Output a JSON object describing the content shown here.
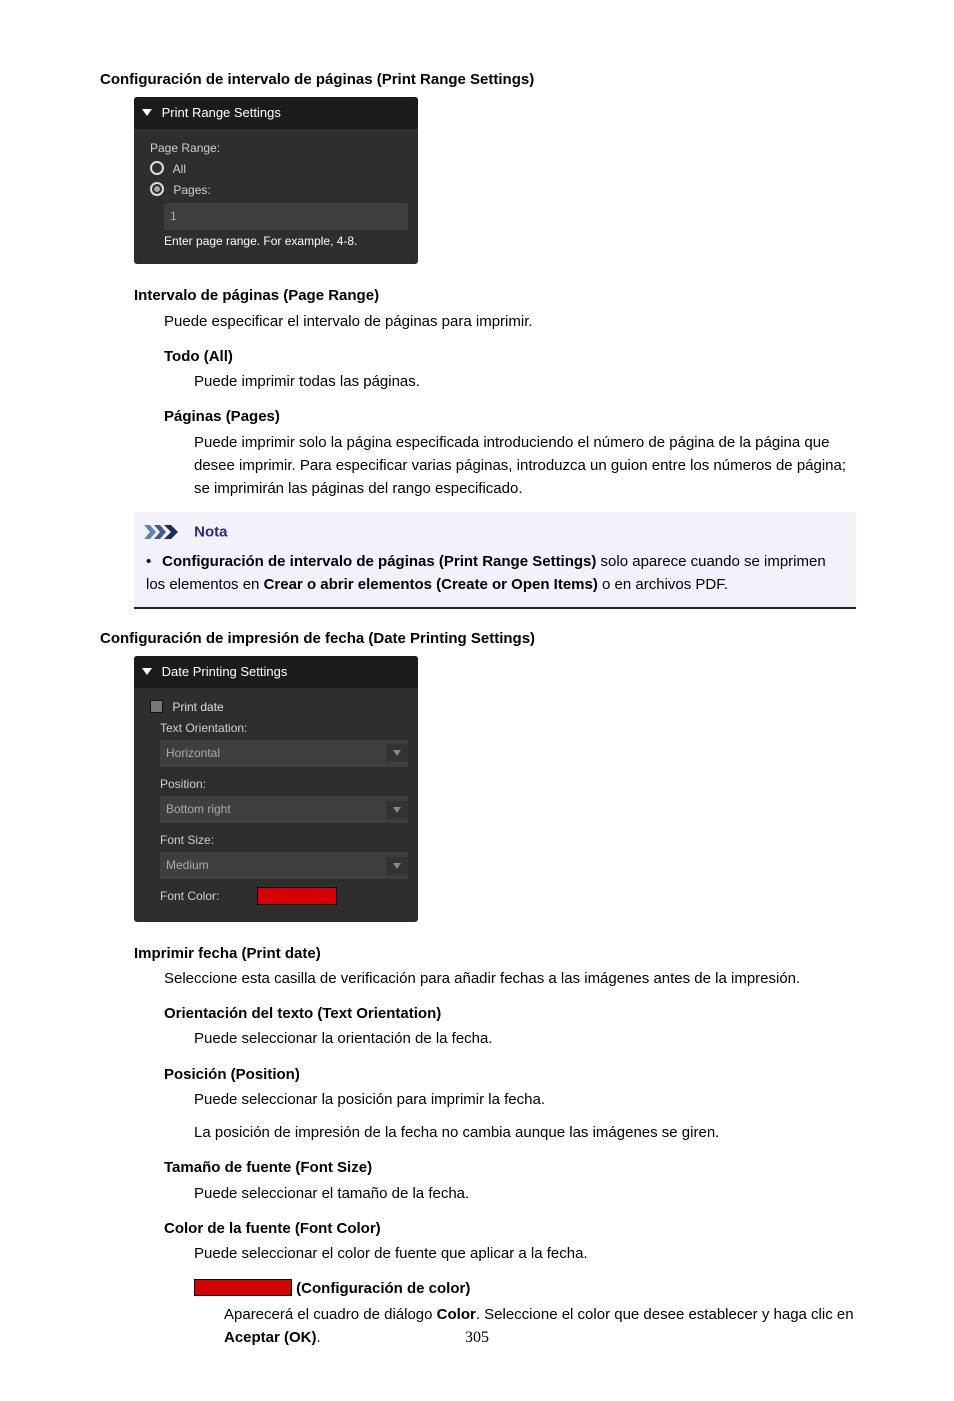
{
  "section1": {
    "heading": "Configuración de intervalo de páginas (Print Range Settings)",
    "panel": {
      "title": "Print Range Settings",
      "label_range": "Page Range:",
      "opt_all": "All",
      "opt_pages": "Pages:",
      "input_value": "1",
      "hint": "Enter page range. For example, 4-8."
    },
    "item1": {
      "term": "Intervalo de páginas (Page Range)",
      "desc": "Puede especificar el intervalo de páginas para imprimir."
    },
    "item1a": {
      "term": "Todo (All)",
      "desc": "Puede imprimir todas las páginas."
    },
    "item1b": {
      "term": "Páginas (Pages)",
      "desc": "Puede imprimir solo la página especificada introduciendo el número de página de la página que desee imprimir. Para especificar varias páginas, introduzca un guion entre los números de página; se imprimirán las páginas del rango especificado."
    },
    "note": {
      "title": "Nota",
      "b1": "Configuración de intervalo de páginas (Print Range Settings)",
      "t1": " solo aparece cuando se imprimen los elementos en ",
      "b2": "Crear o abrir elementos (Create or Open Items)",
      "t2": " o en archivos PDF."
    }
  },
  "section2": {
    "heading": "Configuración de impresión de fecha (Date Printing Settings)",
    "panel": {
      "title": "Date Printing Settings",
      "cb": "Print date",
      "l_orient": "Text Orientation:",
      "v_orient": "Horizontal",
      "l_pos": "Position:",
      "v_pos": "Bottom right",
      "l_size": "Font Size:",
      "v_size": "Medium",
      "l_color": "Font Color:"
    },
    "item1": {
      "term": "Imprimir fecha (Print date)",
      "desc": "Seleccione esta casilla de verificación para añadir fechas a las imágenes antes de la impresión."
    },
    "item1a": {
      "term": "Orientación del texto (Text Orientation)",
      "desc": "Puede seleccionar la orientación de la fecha."
    },
    "item1b": {
      "term": "Posición (Position)",
      "desc1": "Puede seleccionar la posición para imprimir la fecha.",
      "desc2": "La posición de impresión de la fecha no cambia aunque las imágenes se giren."
    },
    "item1c": {
      "term": "Tamaño de fuente (Font Size)",
      "desc": "Puede seleccionar el tamaño de la fecha."
    },
    "item1d": {
      "term": "Color de la fuente (Font Color)",
      "desc": "Puede seleccionar el color de fuente que aplicar a la fecha."
    },
    "item1e": {
      "term_suffix": " (Configuración de color)",
      "desc_a": "Aparecerá el cuadro de diálogo ",
      "desc_b": "Color",
      "desc_c": ". Seleccione el color que desee establecer y haga clic en ",
      "desc_d": "Aceptar (OK)",
      "desc_e": "."
    }
  },
  "page_number": "305"
}
